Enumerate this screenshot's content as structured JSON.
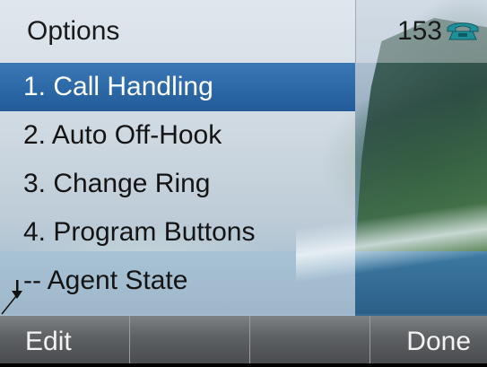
{
  "header": {
    "title": "Options",
    "extension": "153",
    "status_icon": "phone-handset-icon"
  },
  "menu": {
    "items": [
      {
        "label": "1.  Call Handling",
        "selected": true
      },
      {
        "label": "2.  Auto Off-Hook",
        "selected": false
      },
      {
        "label": "3.  Change Ring",
        "selected": false
      },
      {
        "label": "4.  Program Buttons",
        "selected": false
      },
      {
        "label": "--   Agent State",
        "selected": false
      }
    ],
    "scroll_icon": "down-arrow-icon"
  },
  "softkeys": [
    {
      "label": "Edit"
    },
    {
      "label": ""
    },
    {
      "label": ""
    },
    {
      "label": "Done"
    }
  ],
  "colors": {
    "selection": "#2c68a6",
    "softkey_bar": "#5e6164",
    "icon_teal": "#1f8f9a"
  }
}
